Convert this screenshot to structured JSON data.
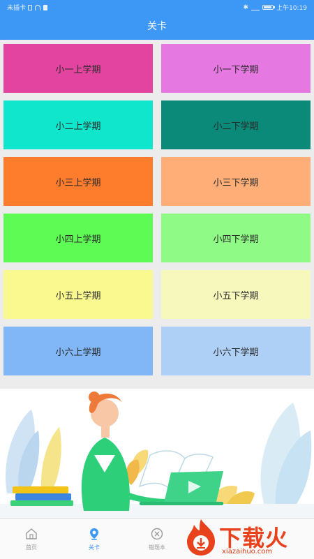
{
  "status_bar": {
    "carrier": "未插卡",
    "time": "上午10:19",
    "bluetooth": "✱"
  },
  "header": {
    "title": "关卡"
  },
  "levels": [
    {
      "label": "小一上学期",
      "color": "#e2449f"
    },
    {
      "label": "小一下学期",
      "color": "#e678e2"
    },
    {
      "label": "小二上学期",
      "color": "#0fe6cc"
    },
    {
      "label": "小二下学期",
      "color": "#0b8a7a"
    },
    {
      "label": "小三上学期",
      "color": "#fd7d2c"
    },
    {
      "label": "小三下学期",
      "color": "#ffae78"
    },
    {
      "label": "小四上学期",
      "color": "#5dfb54"
    },
    {
      "label": "小四下学期",
      "color": "#8ffb86"
    },
    {
      "label": "小五上学期",
      "color": "#f9f990"
    },
    {
      "label": "小五下学期",
      "color": "#f7f9bc"
    },
    {
      "label": "小六上学期",
      "color": "#82b7f7"
    },
    {
      "label": "小六下学期",
      "color": "#afd0f6"
    }
  ],
  "tabs": [
    {
      "label": "首页",
      "icon": "home-icon",
      "active": false
    },
    {
      "label": "关卡",
      "icon": "location-pin-icon",
      "active": true
    },
    {
      "label": "错题本",
      "icon": "close-circle-icon",
      "active": false
    }
  ],
  "watermark": {
    "text": "下载火",
    "url": "xiazaihuo.com"
  },
  "colors": {
    "accent": "#3d97f5",
    "background": "#ececec"
  }
}
